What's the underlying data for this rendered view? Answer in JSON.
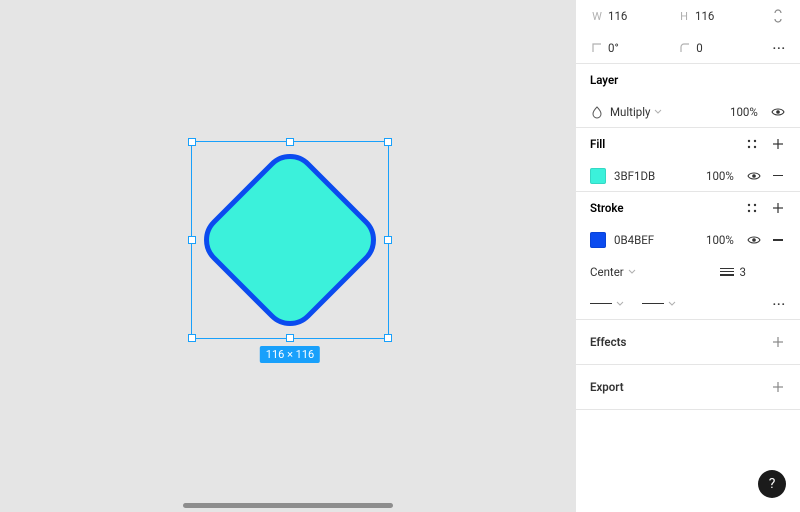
{
  "dims": {
    "w_label": "W",
    "w_value": "116",
    "h_label": "H",
    "h_value": "116",
    "rotation_label": "0°",
    "corner_radius": "0"
  },
  "layer": {
    "title": "Layer",
    "blend_mode": "Multiply",
    "opacity": "100%"
  },
  "fill": {
    "title": "Fill",
    "hex": "3BF1DB",
    "color": "#3BF1DB",
    "opacity": "100%"
  },
  "stroke": {
    "title": "Stroke",
    "hex": "0B4BEF",
    "color": "#0B4BEF",
    "opacity": "100%",
    "align": "Center",
    "weight": "3"
  },
  "effects": {
    "title": "Effects"
  },
  "export": {
    "title": "Export"
  },
  "selection_badge": "116 × 116",
  "help_label": "?"
}
